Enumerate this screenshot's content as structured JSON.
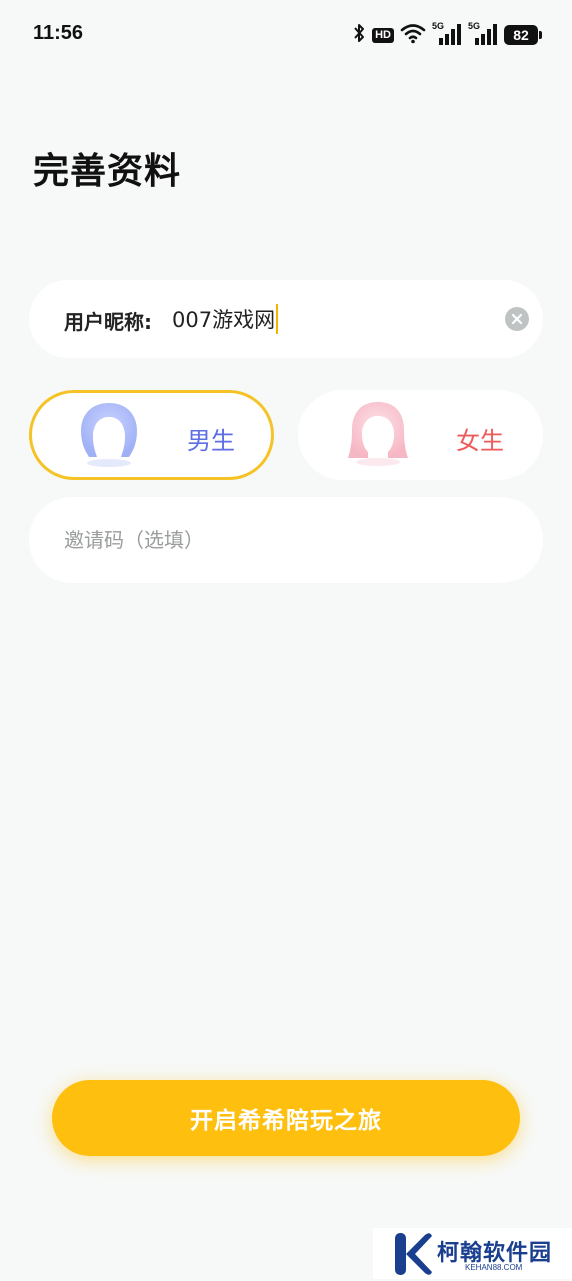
{
  "status_bar": {
    "time": "11:56",
    "battery": "82",
    "hd_label": "HD",
    "network_labels": [
      "5G",
      "5G"
    ]
  },
  "page": {
    "title": "完善资料"
  },
  "nickname": {
    "label": "用户昵称:",
    "value": "007游戏网"
  },
  "gender": {
    "male_label": "男生",
    "female_label": "女生",
    "selected": "male",
    "male_color": "#5d6ee6",
    "female_color": "#ee5a5a",
    "selected_border_color": "#f5c327"
  },
  "invite": {
    "placeholder": "邀请码（选填）",
    "value": ""
  },
  "start_button": {
    "label": "开启希希陪玩之旅",
    "color": "#ffbf0f"
  },
  "watermark": {
    "name": "柯翰软件园",
    "url": "KEHAN88.COM"
  }
}
